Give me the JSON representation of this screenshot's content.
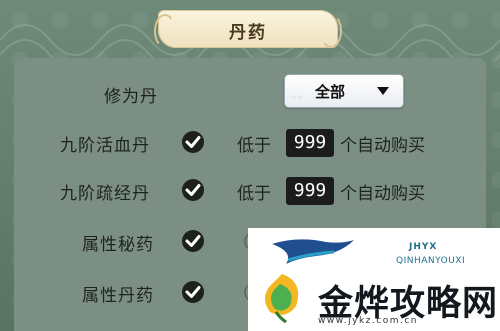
{
  "header": {
    "title": "丹药"
  },
  "filter": {
    "label": "修为丹",
    "dropdown_value": "全部"
  },
  "rows": [
    {
      "label": "九阶活血丹",
      "checked": true,
      "prefix": "低于",
      "threshold": "999",
      "suffix": "个自动购买"
    },
    {
      "label": "九阶疏经丹",
      "checked": true,
      "prefix": "低于",
      "threshold": "999",
      "suffix": "个自动购买"
    },
    {
      "label": "属性秘药",
      "checked": true,
      "partial": "（"
    },
    {
      "label": "属性丹药",
      "checked": true,
      "partial": "（"
    }
  ],
  "watermark": {
    "badge": "JHYX",
    "sub": "QINHANYOUXI",
    "brand": "金烨攻略网",
    "url": "www.jykz.com.cn"
  },
  "colors": {
    "accent": "#1c211d",
    "panel": "#7b8f84",
    "plaque": "#f3e7c6"
  }
}
